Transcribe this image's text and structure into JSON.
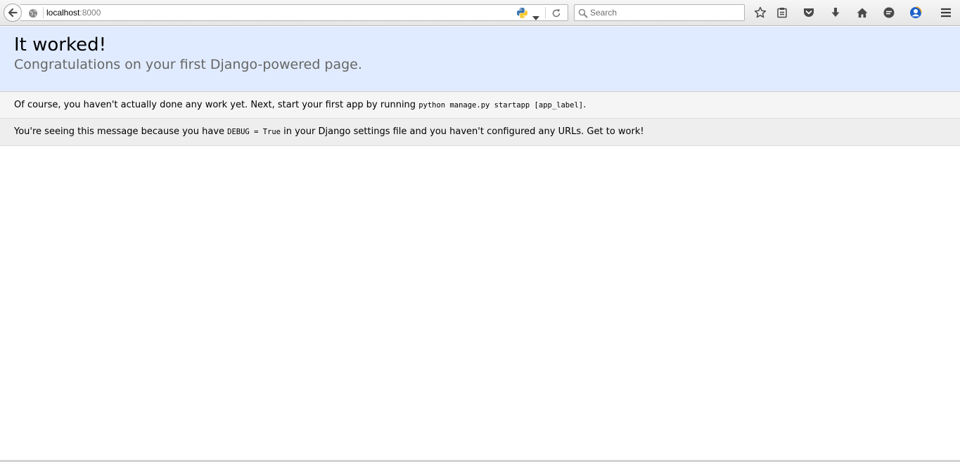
{
  "browser": {
    "url_host": "localhost",
    "url_port": ":8000",
    "search_placeholder": "Search",
    "toolbar_icons": [
      "back-icon",
      "globe-icon",
      "python-icon",
      "dropdown-icon",
      "reload-icon",
      "search-icon",
      "bookmark-star-icon",
      "reading-list-icon",
      "pocket-icon",
      "download-icon",
      "home-icon",
      "chat-icon",
      "profile-icon",
      "menu-icon"
    ]
  },
  "page": {
    "title": "It worked!",
    "subtitle": "Congratulations on your first Django-powered page.",
    "instructions": {
      "prefix": "Of course, you haven't actually done any work yet. Next, start your first app by running ",
      "code": "python manage.py startapp [app_label]",
      "suffix": "."
    },
    "explanation": {
      "prefix": "You're seeing this message because you have ",
      "code": "DEBUG = True",
      "suffix": " in your Django settings file and you haven't configured any URLs. Get to work!"
    }
  }
}
